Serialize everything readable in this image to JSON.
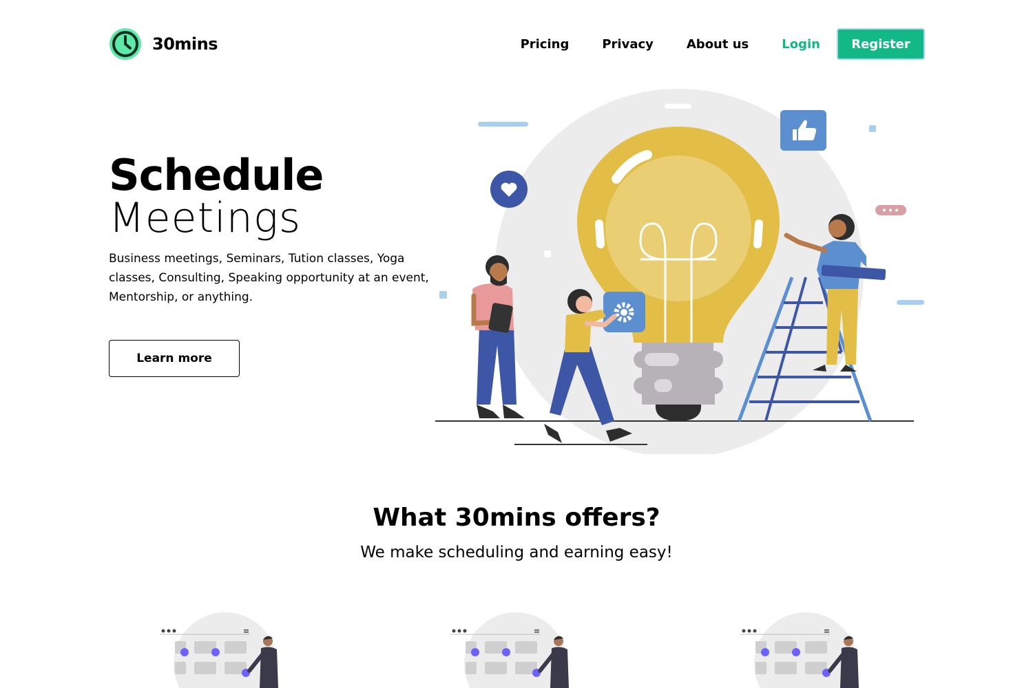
{
  "brand": {
    "name": "30mins",
    "accent": "#12b886",
    "logo_ring": "#5ee9a6"
  },
  "nav": {
    "items": [
      {
        "label": "Pricing"
      },
      {
        "label": "Privacy"
      },
      {
        "label": "About us"
      }
    ],
    "login": "Login",
    "register": "Register"
  },
  "hero": {
    "title_bold": "Schedule",
    "title_light": "Meetings",
    "description": "Business meetings, Seminars, Tution classes, Yoga classes, Consulting, Speaking opportunity at an event, Mentorship, or anything.",
    "cta": "Learn more"
  },
  "offers": {
    "title": "What 30mins offers?",
    "subtitle": "We make scheduling and earning easy!"
  }
}
